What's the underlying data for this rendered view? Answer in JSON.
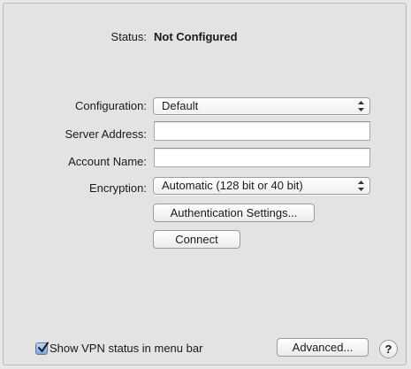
{
  "status": {
    "label": "Status:",
    "value": "Not Configured"
  },
  "form": {
    "configuration": {
      "label": "Configuration:",
      "selected": "Default"
    },
    "server_address": {
      "label": "Server Address:",
      "value": ""
    },
    "account_name": {
      "label": "Account Name:",
      "value": ""
    },
    "encryption": {
      "label": "Encryption:",
      "selected": "Automatic (128 bit or 40 bit)"
    }
  },
  "buttons": {
    "authentication_settings": "Authentication Settings...",
    "connect": "Connect",
    "advanced": "Advanced...",
    "help": "?"
  },
  "footer": {
    "show_vpn_status_label": "Show VPN status in menu bar",
    "show_vpn_status_checked": true
  },
  "icons": {
    "popup_arrows": "updown-arrows-icon",
    "checkmark": "checkmark-icon"
  },
  "colors": {
    "checkbox_accent": "#7aa7e0"
  }
}
